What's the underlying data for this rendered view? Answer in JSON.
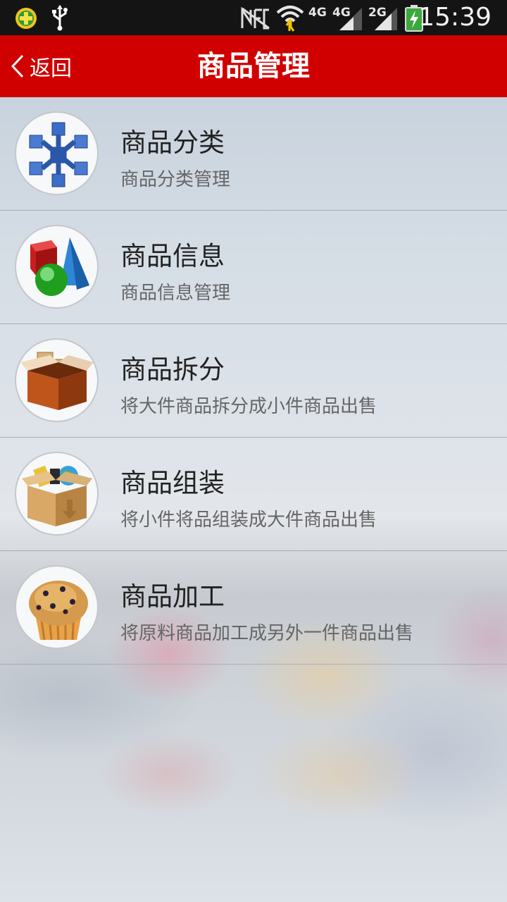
{
  "status_bar": {
    "time": "15:39",
    "icons": [
      "app-plus-icon",
      "usb-icon",
      "nfc-muted-icon",
      "wifi-icon",
      "signal-4g-icon",
      "signal-4g-icon",
      "signal-2g-icon",
      "battery-charging-icon"
    ],
    "net_labels": [
      "4G",
      "4G",
      "2G"
    ]
  },
  "header": {
    "back_label": "返回",
    "title": "商品管理",
    "background": "#d10000"
  },
  "items": [
    {
      "icon": "structure-cubes-icon",
      "title": "商品分类",
      "subtitle": "商品分类管理"
    },
    {
      "icon": "shapes-icon",
      "title": "商品信息",
      "subtitle": "商品信息管理"
    },
    {
      "icon": "open-box-icon",
      "title": "商品拆分",
      "subtitle": "将大件商品拆分成小件商品出售"
    },
    {
      "icon": "package-assemble-icon",
      "title": "商品组装",
      "subtitle": "将小件将品组装成大件商品出售"
    },
    {
      "icon": "muffin-icon",
      "title": "商品加工",
      "subtitle": "将原料商品加工成另外一件商品出售"
    }
  ]
}
